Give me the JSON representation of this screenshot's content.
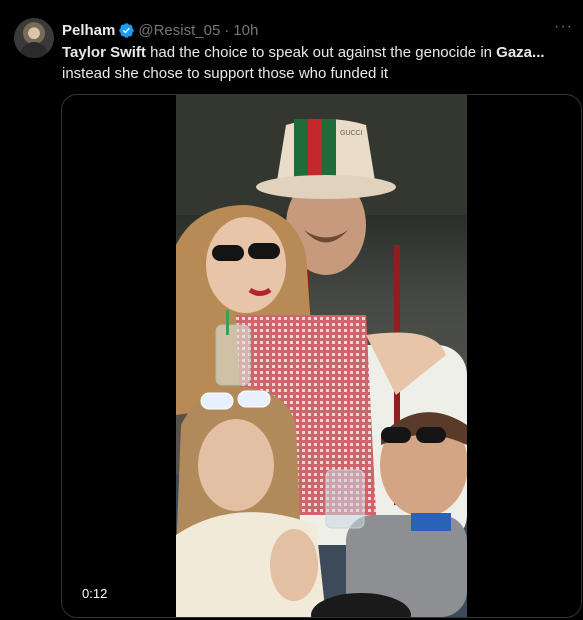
{
  "author": {
    "name": "Pelham",
    "handle": "@Resist_05",
    "separator": "·",
    "time": "10h",
    "verified_color": "#1d9bf0"
  },
  "tweet": {
    "text_part1": "Taylor Swift",
    "text_part2": " had the choice to speak out against the genocide in ",
    "text_part3": "Gaza...",
    "text_part4": "instead she chose to support those who funded it"
  },
  "media": {
    "duration": "0:12",
    "hat_text": "GUCCI"
  },
  "icons": {
    "more": "more-icon",
    "verified": "verified-badge-icon"
  }
}
